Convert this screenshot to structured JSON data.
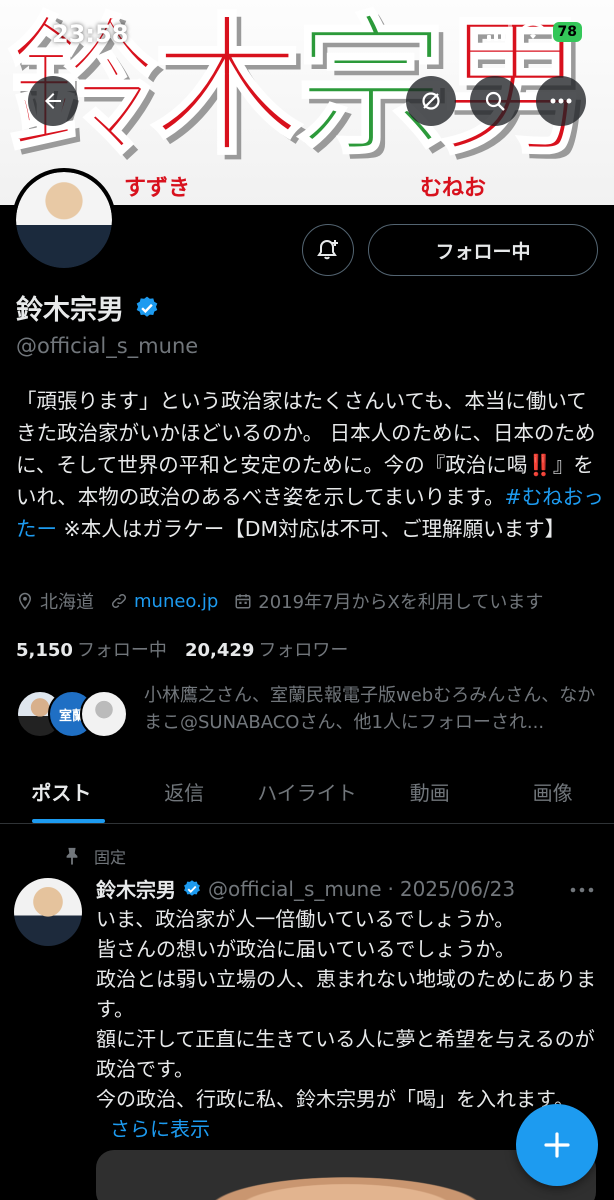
{
  "status_bar": {
    "time": "23:58",
    "battery": "78"
  },
  "banner": {
    "title_chars": [
      "鈴",
      "木",
      "宗",
      "男"
    ],
    "furigana_left": "すずき",
    "furigana_right": "むねお"
  },
  "profile": {
    "follow_label": "フォロー中",
    "display_name": "鈴木宗男",
    "handle": "@official_s_mune",
    "bio_part1": "「頑張ります」という政治家はたくさんいても、本当に働いてきた政治家がいかほどいるのか。 日本人のために、日本のために、そして世界の平和と安定のために。今の『政治に喝",
    "bio_mark": "‼️",
    "bio_part2": "』をいれ、本物の政治のあるべき姿を示してまいります。",
    "bio_hashtag": "#むねおったー",
    "bio_part3": " ※本人はガラケー【DM対応は不可、ご理解願います】",
    "location": "北海道",
    "website": "muneo.jp",
    "joined": "2019年7月からXを利用しています",
    "following_count": "5,150",
    "following_label": "フォロー中",
    "followers_count": "20,429",
    "followers_label": "フォロワー",
    "followed_by_text": "小林鷹之さん、室蘭民報電子版webむろみんさん、なかまこ@SUNABACOさん、他1人にフォローされ...",
    "mini_avatar_text": "室蘭"
  },
  "tabs": [
    "ポスト",
    "返信",
    "ハイライト",
    "動画",
    "画像"
  ],
  "post": {
    "pinned_label": "固定",
    "name": "鈴木宗男",
    "handle": "@official_s_mune",
    "separator": "·",
    "date": "2025/06/23",
    "lines": [
      "いま、政治家が人一倍働いているでしょうか。",
      "皆さんの想いが政治に届いているでしょうか。",
      "政治とは弱い立場の人、恵まれない地域のためにあります。",
      "額に汗して正直に生きている人に夢と希望を与えるのが政治です。",
      "今の政治、行政に私、鈴木宗男が「喝」を入れます。"
    ],
    "show_more": "さらに表示"
  },
  "colors": {
    "accent": "#1d9bf0",
    "background": "#000000",
    "banner_red": "#d8111d",
    "banner_green": "#2c9a3a"
  }
}
